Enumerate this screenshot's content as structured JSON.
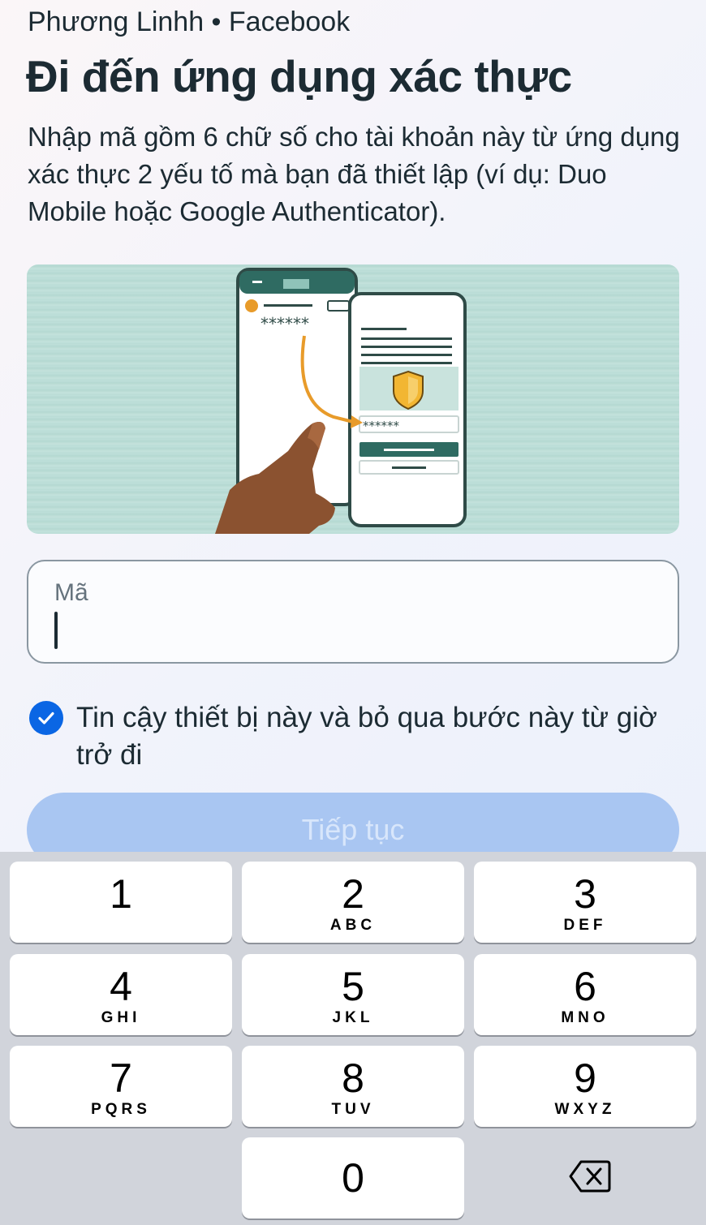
{
  "header": {
    "account": "Phương Linhh • Facebook",
    "title": "Đi đến ứng dụng xác thực",
    "description": "Nhập mã gồm 6 chữ số cho tài khoản này từ ứng dụng xác thực 2 yếu tố mà bạn đã thiết lập (ví dụ: Duo Mobile hoặc Google Authenticator)."
  },
  "illustration": {
    "code_mask": "******",
    "code_mask_small": "******",
    "icon": "shield-icon"
  },
  "code_field": {
    "label": "Mã",
    "value": ""
  },
  "trust_device": {
    "checked": true,
    "label": "Tin cậy thiết bị này và bỏ qua bước này từ giờ trở đi"
  },
  "continue_button": {
    "label": "Tiếp tục"
  },
  "keyboard": {
    "keys": [
      {
        "num": "1",
        "letters": ""
      },
      {
        "num": "2",
        "letters": "ABC"
      },
      {
        "num": "3",
        "letters": "DEF"
      },
      {
        "num": "4",
        "letters": "GHI"
      },
      {
        "num": "5",
        "letters": "JKL"
      },
      {
        "num": "6",
        "letters": "MNO"
      },
      {
        "num": "7",
        "letters": "PQRS"
      },
      {
        "num": "8",
        "letters": "TUV"
      },
      {
        "num": "9",
        "letters": "WXYZ"
      },
      {
        "num": "0",
        "letters": ""
      }
    ]
  },
  "colors": {
    "accent": "#0a66e4",
    "button_disabled": "#a9c6f2",
    "illustration_bg": "#bcdcd6",
    "keyboard_bg": "#d1d4db"
  }
}
